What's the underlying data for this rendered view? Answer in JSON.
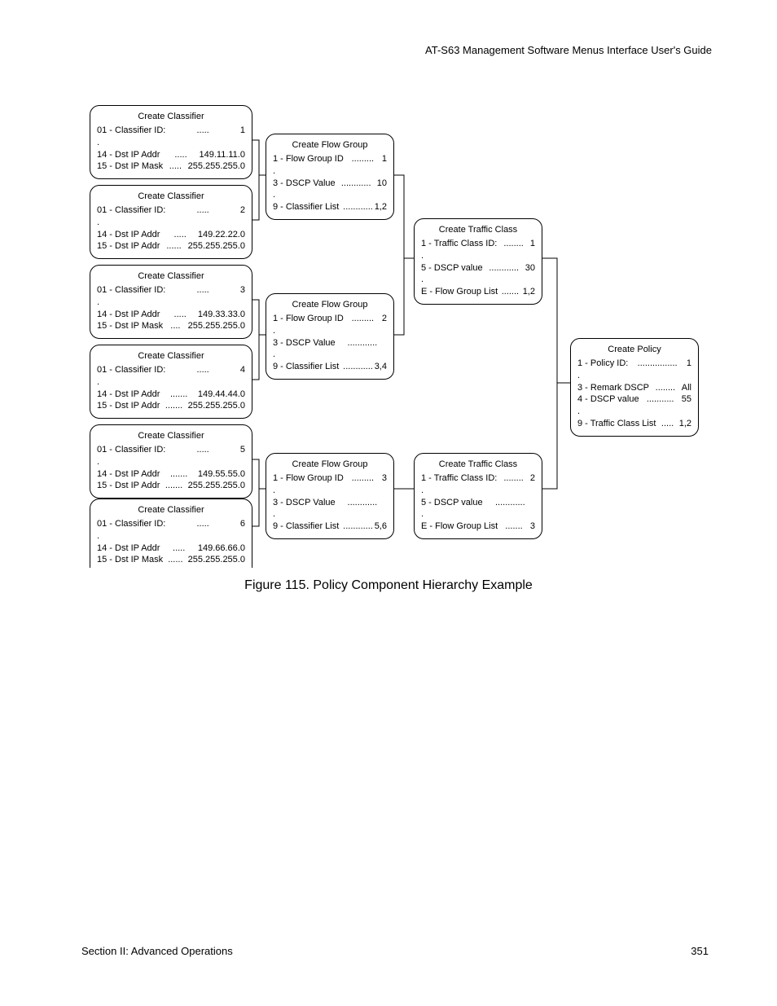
{
  "header": "AT-S63 Management Software Menus Interface User's Guide",
  "footer_left": "Section II: Advanced Operations",
  "footer_right": "351",
  "caption": "Figure 115. Policy Component Hierarchy Example",
  "classifiers": [
    {
      "title": "Create Classifier",
      "id_label": "01 - Classifier ID:",
      "id_val": "1",
      "addr_label": "14 - Dst IP Addr",
      "addr_val": "149.11.11.0",
      "mask_label": "15 - Dst IP Mask",
      "mask_val": "255.255.255.0"
    },
    {
      "title": "Create Classifier",
      "id_label": "01 - Classifier ID:",
      "id_val": "2",
      "addr_label": "14 - Dst IP Addr",
      "addr_val": "149.22.22.0",
      "mask_label": "15 - Dst IP Addr",
      "mask_val": "255.255.255.0"
    },
    {
      "title": "Create Classifier",
      "id_label": "01 - Classifier ID:",
      "id_val": "3",
      "addr_label": "14 - Dst IP Addr",
      "addr_val": "149.33.33.0",
      "mask_label": "15 - Dst IP Mask",
      "mask_val": "255.255.255.0"
    },
    {
      "title": "Create Classifier",
      "id_label": "01 - Classifier ID:",
      "id_val": "4",
      "addr_label": "14 - Dst IP Addr",
      "addr_val": "149.44.44.0",
      "mask_label": "15 - Dst IP Addr",
      "mask_val": "255.255.255.0"
    },
    {
      "title": "Create Classifier",
      "id_label": "01 - Classifier ID:",
      "id_val": "5",
      "addr_label": "14 - Dst IP Addr",
      "addr_val": "149.55.55.0",
      "mask_label": "15 - Dst IP Addr",
      "mask_val": "255.255.255.0"
    },
    {
      "title": "Create Classifier",
      "id_label": "01 - Classifier ID:",
      "id_val": "6",
      "addr_label": "14 - Dst IP Addr",
      "addr_val": "149.66.66.0",
      "mask_label": "15 - Dst IP Mask",
      "mask_val": "255.255.255.0"
    }
  ],
  "flowgroups": [
    {
      "title": "Create Flow Group",
      "id_label": "1 - Flow Group ID",
      "id_val": "1",
      "dscp_label": "3 - DSCP Value",
      "dscp_val": "10",
      "list_label": "9 - Classifier List",
      "list_val": "1,2"
    },
    {
      "title": "Create Flow Group",
      "id_label": "1 - Flow Group ID",
      "id_val": "2",
      "dscp_label": "3 - DSCP Value",
      "dscp_val": "",
      "list_label": "9 - Classifier List",
      "list_val": "3,4"
    },
    {
      "title": "Create Flow Group",
      "id_label": "1 - Flow Group ID",
      "id_val": "3",
      "dscp_label": "3 - DSCP Value",
      "dscp_val": "",
      "list_label": "9 - Classifier List",
      "list_val": "5,6"
    }
  ],
  "traffic": [
    {
      "title": "Create Traffic Class",
      "id_label": "1 - Traffic Class ID:",
      "id_val": "1",
      "dscp_label": "5 - DSCP value",
      "dscp_val": "30",
      "list_label": "E - Flow Group List",
      "list_val": "1,2"
    },
    {
      "title": "Create Traffic Class",
      "id_label": "1 - Traffic Class ID:",
      "id_val": "2",
      "dscp_label": "5 - DSCP value",
      "dscp_val": "",
      "list_label": "E - Flow Group List",
      "list_val": "3"
    }
  ],
  "policy": {
    "title": "Create Policy",
    "id_label": "1 - Policy ID:",
    "id_val": "1",
    "remark_label": "3 - Remark DSCP",
    "remark_val": "All",
    "dscp_label": "4 - DSCP value",
    "dscp_val": "55",
    "list_label": "9 - Traffic Class List",
    "list_val": "1,2"
  }
}
